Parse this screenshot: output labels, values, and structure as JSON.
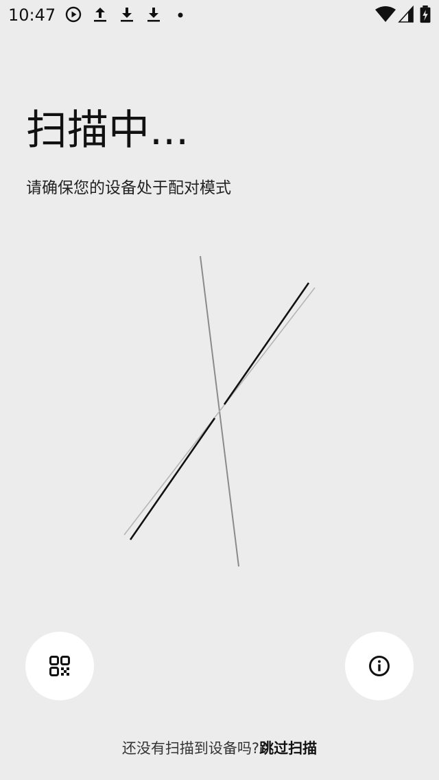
{
  "status_bar": {
    "time": "10:47",
    "icons": [
      "play-circle-icon",
      "upload-icon",
      "download-icon",
      "download-icon",
      "dot-icon",
      "wifi-icon",
      "signal-icon",
      "battery-charging-icon"
    ]
  },
  "main": {
    "title": "扫描中...",
    "subtitle": "请确保您的设备处于配对模式"
  },
  "actions": {
    "qr_icon": "qr-code-icon",
    "info_icon": "info-icon"
  },
  "footer": {
    "prompt": "还没有扫描到设备吗?",
    "skip_label": "跳过扫描"
  }
}
